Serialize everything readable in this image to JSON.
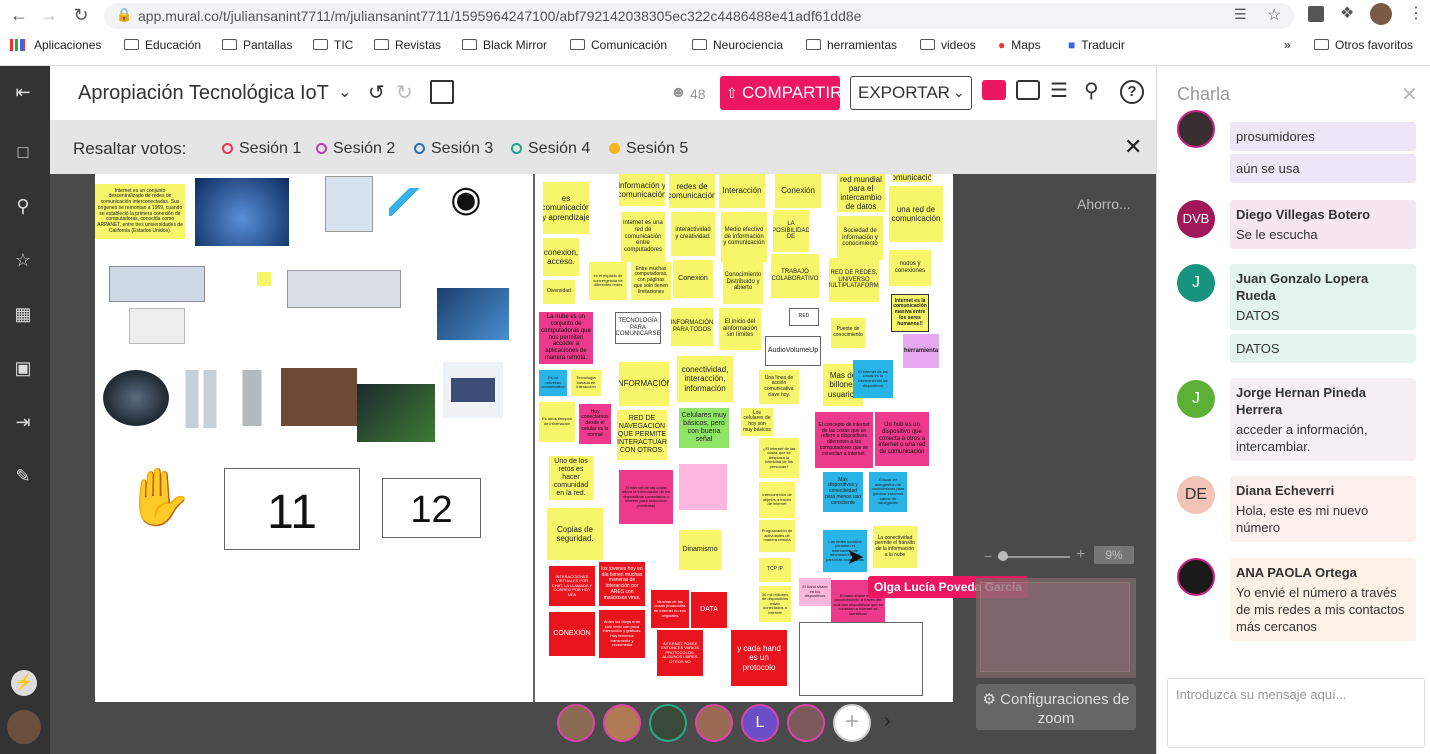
{
  "browser": {
    "url": "app.mural.co/t/juliansanint7711/m/juliansanint7711/1595964247100/abf792142038305ec322c4486488e41adf61dd8e",
    "bookmarks": [
      "Aplicaciones",
      "Educación",
      "Pantallas",
      "TIC",
      "Revistas",
      "Black Mirror",
      "Comunicación",
      "Neurociencia",
      "herramientas",
      "videos",
      "Maps",
      "Traducir",
      "Otros favoritos"
    ]
  },
  "header": {
    "title": "Apropiación Tecnológica IoT",
    "participants": "48",
    "share_label": "COMPARTIR",
    "export_label": "EXPORTAR"
  },
  "votes": {
    "label": "Resaltar votos:",
    "sessions": [
      {
        "label": "Sesión 1",
        "color": "#e8365b"
      },
      {
        "label": "Sesión 2",
        "color": "#b83fb8"
      },
      {
        "label": "Sesión 3",
        "color": "#2a6fb3"
      },
      {
        "label": "Sesión 4",
        "color": "#21a38f"
      },
      {
        "label": "Sesión 5",
        "color": "#f3b51b"
      }
    ]
  },
  "canvas": {
    "autosave": "Ahorro...",
    "zoom": "9%",
    "zoom_settings": "Configuraciones de zoom",
    "cursor_label": "Olga Lucía Poveda García",
    "card_11": "11",
    "card_12": "12",
    "notes": {
      "n1": "Internet es un conjunto descentralizado de redes de comunicación interconectadas. Sus orígenes se remontan a 1969, cuando se estableció la primera conexión de computadoras, conocida como ARPANET, entre tres universidades de California (Estados Unidos).",
      "n2": "es comunicación y aprendizaje",
      "n3": "información y comunicación",
      "n4": "redes de comunicación",
      "n5": "Interacción",
      "n6": "Conexión",
      "n7": "red mundial para el intercambio de datos",
      "n8": "comunicación",
      "n9": "una red de comunicación",
      "n10": "internet es una red de comunicación entre computadores",
      "n11": "interactividad y creatividad.",
      "n12": "Medio efectivo de información y comunicación",
      "n13": "LA POSIBILIDAD DE",
      "n14": "Sociedad de información y conocimiento",
      "n15": "conexion, acceso.",
      "n16": "es el espacio de convergencia de diferentes redes",
      "n17": "Entre muchas computadoras, con páginas que solo tienen limitaciones",
      "n18": "Conexión",
      "n19": "Conocimiento Distribuido y abierto",
      "n20": "TRABAJO COLABORATIVO",
      "n21": "RED DE REDES, UNIVERSO MULTIPLATAFORMA",
      "n22": "nodos y conexiones",
      "n23": "Internet es la comunicación masiva entre los seres humanos!!",
      "n24": "Diversidad",
      "n25": "La nube es un conjunto de computadoras que nos permiten acceder a aplicaciones de manera remota.",
      "n26": "TECNOLOGÍA PARA COMUNICARSE",
      "n27": "INFORMACIÓN PARA TODOS",
      "n28": "El inicio del ainformación sin límites",
      "n29": "RED",
      "n30": "Puente de conocimiento",
      "n31": "herramienta",
      "n32": "AudioVolumeUp",
      "n33": "Es un universo comunicativo",
      "n34": "Tecnología basada en interacción",
      "n35": "INFORMACIÓN",
      "n36": "conectividad, interacción, información",
      "n37": "Una línea de acción comunicativa clave hoy.",
      "n38": "Mas de billones usuarios",
      "n39": "El internet de las cosas es la interconexión de dispositivos",
      "n40": "Es otros tiempos de información",
      "n41": "Hoy conectarnos desde el celular es lo normal",
      "n42": "RED DE NAVEGACIÓN QUE PERMITE INTERACTUAR CON OTROS.",
      "n43": "Celulares muy básicos, pero con buena señal",
      "n44": "Los celulares de hoy son muy básicos",
      "n45": "El concepto de internet de las cosas que se refiere a dispositivos diferentes a los computadores que se conectan a internet.",
      "n46": "Un hub es un dispositivo que conecta a otros a internet o una red de comunicación",
      "n47": "Uno de los retos es hacer comunidad en la red.",
      "n48": "El internet de las cosas utiliza la información de los dispositivos conectados a internet para solucionar problemas",
      "n49": "¿El internet de las cosas que se desplaza la intimidad de las personas?",
      "n50": "Más dispositivos y conectividad para menos uso consciente",
      "n51": "Educar en autogestión de conocimiento para generar entornos sanos de navegación",
      "n52": "Copias de seguridad.",
      "n53": "Dinamismo",
      "n54": "Interconexión de objetos a través de internet",
      "n55": "Programación de actividades de manera remota",
      "n56": "Las redes sociales permiten el intercambio de información para personas conectadas",
      "n57": "La conectividad permite el tránsito de la información a la nube",
      "n58": "INTERACCIONES VIRTUALES POR CHAT, LA LLAMADA Y CORREO POR HOY NEA",
      "n59": "los jóvenes hoy en día tienen muchas maneras de interacción por ARES con maliciosos virus.",
      "n60": "TCP IP",
      "n61": "30 mil millones de dispositivos están conectados a internet",
      "n62": "El hand shake es un procedimiento a través del cual dos dispositivos que se conectan a internet se identifican",
      "n63": "El hand shake en los dispositivos",
      "n64": "CONEXIÓN",
      "n65": "Antes los blogs eran solo texto con poca interacción y gráficas. Hoy tenemos transmedia y crossmedia",
      "n66": "Muchas de las cosas producidas en Internet no son originales",
      "n67": "DATA",
      "n68": "INTERNET POSEE ENTONCES VARIOS PROTOCOLOS: ALGUNOS LIBRES OTROS NO",
      "n69": "y cada hand es un protocolo"
    }
  },
  "chat": {
    "title": "Charla",
    "messages": [
      {
        "name": "",
        "lines": [
          "prosumidores"
        ]
      },
      {
        "name": "",
        "lines": [
          "aún se usa"
        ]
      },
      {
        "name": "Diego Villegas Botero",
        "initials": "DVB",
        "lines": [
          "Se le escucha"
        ]
      },
      {
        "name": "Juan Gonzalo Lopera Rueda",
        "initials": "J",
        "lines": [
          "DATOS"
        ]
      },
      {
        "name": "",
        "lines": [
          "DATOS"
        ]
      },
      {
        "name": "Jorge Hernan Pineda Herrera",
        "initials": "J",
        "lines": [
          "acceder a información, intercambiar."
        ]
      },
      {
        "name": "Diana Echeverri",
        "initials": "DE",
        "lines": [
          "Hola, este es mi nuevo número"
        ]
      },
      {
        "name": "ANA PAOLA Ortega",
        "lines": [
          "Yo envié el número a través de mis redes a mis contactos más cercanos"
        ]
      }
    ],
    "input_placeholder": "Introduzca su mensaje aquí..."
  },
  "bottom": {
    "avatar_l": "L"
  }
}
